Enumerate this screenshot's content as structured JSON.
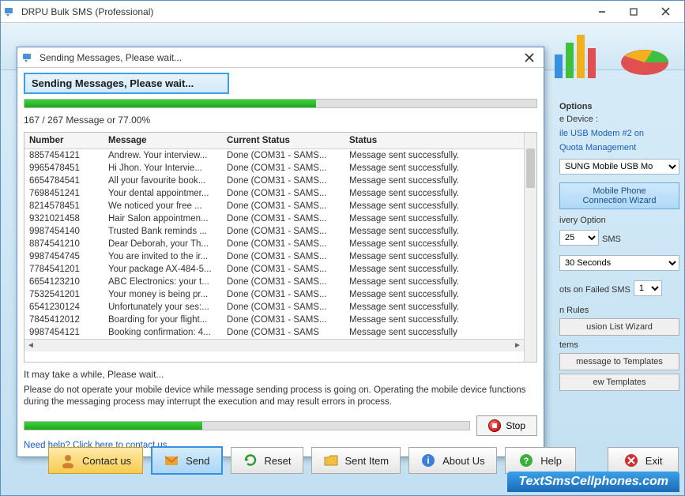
{
  "app": {
    "title": "DRPU Bulk SMS (Professional)"
  },
  "dialog": {
    "title": "Sending Messages, Please wait...",
    "banner": "Sending Messages, Please wait...",
    "progress_percent": 57,
    "progress_text": "167 / 267 Message or 77.00%",
    "columns": {
      "number": "Number",
      "message": "Message",
      "current_status": "Current Status",
      "status": "Status"
    },
    "rows": [
      {
        "number": "8857454121",
        "message": "Andrew. Your interview...",
        "cs": "Done (COM31 - SAMS...",
        "st": "Message sent successfully."
      },
      {
        "number": "9965478451",
        "message": "Hi Jhon. Your Intervie...",
        "cs": "Done (COM31 - SAMS...",
        "st": "Message sent successfully."
      },
      {
        "number": "6654784541",
        "message": "All your favourite book...",
        "cs": "Done (COM31 - SAMS...",
        "st": "Message sent successfully."
      },
      {
        "number": "7698451241",
        "message": "Your dental appointmer...",
        "cs": "Done (COM31 - SAMS...",
        "st": "Message sent successfully."
      },
      {
        "number": "8214578451",
        "message": "We noticed your free ...",
        "cs": "Done (COM31 - SAMS...",
        "st": "Message sent successfully."
      },
      {
        "number": "9321021458",
        "message": "Hair Salon appointmen...",
        "cs": "Done (COM31 - SAMS...",
        "st": "Message sent successfully."
      },
      {
        "number": "9987454140",
        "message": "Trusted Bank reminds ...",
        "cs": "Done (COM31 - SAMS...",
        "st": "Message sent successfully."
      },
      {
        "number": "8874541210",
        "message": "Dear Deborah, your Th...",
        "cs": "Done (COM31 - SAMS...",
        "st": "Message sent successfully."
      },
      {
        "number": "9987454745",
        "message": "You are invited to the ir...",
        "cs": "Done (COM31 - SAMS...",
        "st": "Message sent successfully."
      },
      {
        "number": "7784541201",
        "message": "Your package AX-484-5...",
        "cs": "Done (COM31 - SAMS...",
        "st": "Message sent successfully."
      },
      {
        "number": "6654123210",
        "message": "ABC Electronics: your t...",
        "cs": "Done (COM31 - SAMS...",
        "st": "Message sent successfully."
      },
      {
        "number": "7532541201",
        "message": "Your money is being pr...",
        "cs": "Done (COM31 - SAMS...",
        "st": "Message sent successfully."
      },
      {
        "number": "6541230124",
        "message": "Unfortunately your ses:...",
        "cs": "Done (COM31 - SAMS...",
        "st": "Message sent successfully."
      },
      {
        "number": "7845412012",
        "message": "Boarding for your flight...",
        "cs": "Done (COM31 - SAMS...",
        "st": "Message sent successfully."
      },
      {
        "number": "9987454121",
        "message": "Booking confirmation: 4...",
        "cs": "Done (COM31 - SAMS",
        "st": "Message sent successfully"
      }
    ],
    "wait_text": "It may take a while, Please wait...",
    "warn_text": "Please do not operate your mobile device while message sending process is going on. Operating the mobile device functions during the messaging process may interrupt the execution and may result errors in process.",
    "bottom_progress_percent": 40,
    "stop_label": "Stop",
    "help_link": "Need help? Click here to contact us."
  },
  "options": {
    "heading": "Options",
    "device_label": "e Device :",
    "device_value": "ile USB Modem #2 on",
    "quota_link": "Quota Management",
    "device_select": "SUNG Mobile USB Mo",
    "wizard_line1": "Mobile Phone",
    "wizard_line2": "Connection  Wizard",
    "delivery_heading": "ivery Option",
    "sms_count": "25",
    "sms_suffix": "SMS",
    "delay": "30 Seconds",
    "retry_label": "ots on Failed SMS",
    "retry_value": "1",
    "rules_heading": "n Rules",
    "exclusion_btn": "usion List Wizard",
    "items_heading": "tems",
    "templates_btn1": "message to Templates",
    "templates_btn2": "ew Templates"
  },
  "toolbar": {
    "contact": "Contact us",
    "send": "Send",
    "reset": "Reset",
    "sent_item": "Sent Item",
    "about": "About Us",
    "help": "Help",
    "exit": "Exit"
  },
  "watermark": "TextSmsCellphones.com"
}
